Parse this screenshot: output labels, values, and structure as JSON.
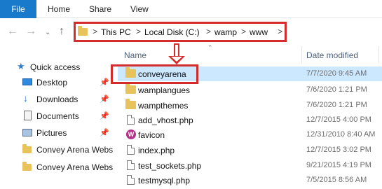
{
  "ribbon": {
    "file": "File",
    "home": "Home",
    "share": "Share",
    "view": "View"
  },
  "address": {
    "crumbs": [
      "This PC",
      "Local Disk (C:)",
      "wamp",
      "www"
    ],
    "separator": ">"
  },
  "columns": {
    "name": "Name",
    "date_modified": "Date modified"
  },
  "sidebar": {
    "items": [
      {
        "label": "Quick access",
        "icon": "star-icon",
        "pinned": false
      },
      {
        "label": "Desktop",
        "icon": "desktop-icon",
        "pinned": true
      },
      {
        "label": "Downloads",
        "icon": "download-icon",
        "pinned": true
      },
      {
        "label": "Documents",
        "icon": "documents-icon",
        "pinned": true
      },
      {
        "label": "Pictures",
        "icon": "pictures-icon",
        "pinned": true
      },
      {
        "label": "Convey Arena Webs",
        "icon": "folder-icon",
        "pinned": false
      },
      {
        "label": "Convey Arena Webs",
        "icon": "folder-icon",
        "pinned": false
      }
    ]
  },
  "files": [
    {
      "name": "conveyarena",
      "date": "7/7/2020 9:45 AM",
      "type": "folder",
      "selected": true
    },
    {
      "name": "wamplangues",
      "date": "7/6/2020 1:21 PM",
      "type": "folder"
    },
    {
      "name": "wampthemes",
      "date": "7/6/2020 1:21 PM",
      "type": "folder"
    },
    {
      "name": "add_vhost.php",
      "date": "12/7/2015 4:00 PM",
      "type": "file"
    },
    {
      "name": "favicon",
      "date": "12/31/2010 8:40 AM",
      "type": "favicon"
    },
    {
      "name": "index.php",
      "date": "12/7/2015 3:02 PM",
      "type": "file"
    },
    {
      "name": "test_sockets.php",
      "date": "9/21/2015 4:19 PM",
      "type": "file"
    },
    {
      "name": "testmysql.php",
      "date": "7/5/2015 8:56 AM",
      "type": "file"
    }
  ],
  "colors": {
    "accent": "#1979ca",
    "highlight": "#d42b2b",
    "selection": "#cce8ff",
    "folder": "#e8c25a"
  }
}
